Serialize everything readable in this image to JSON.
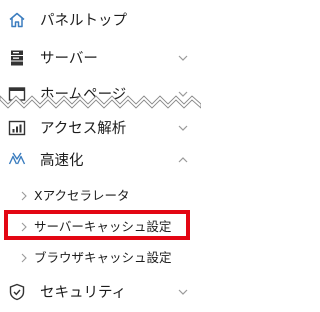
{
  "sidebar": {
    "items": [
      {
        "icon": "home-icon",
        "label": "パネルトップ"
      },
      {
        "icon": "server-icon",
        "label": "サーバー"
      },
      {
        "icon": "browser-window-icon",
        "label": "ホームページ"
      },
      {
        "icon": "analytics-chart-icon",
        "label": "アクセス解析"
      },
      {
        "icon": "speed-arrows-icon",
        "label": "高速化"
      },
      {
        "icon": "shield-icon",
        "label": "セキュリティ"
      }
    ],
    "speed_submenu": [
      {
        "label": "Xアクセラレータ"
      },
      {
        "label": "サーバーキャッシュ設定"
      },
      {
        "label": "ブラウザキャッシュ設定"
      }
    ]
  },
  "colors": {
    "highlight_border": "#e30613",
    "icon": "#444444",
    "chevron": "#9a9a9a"
  }
}
